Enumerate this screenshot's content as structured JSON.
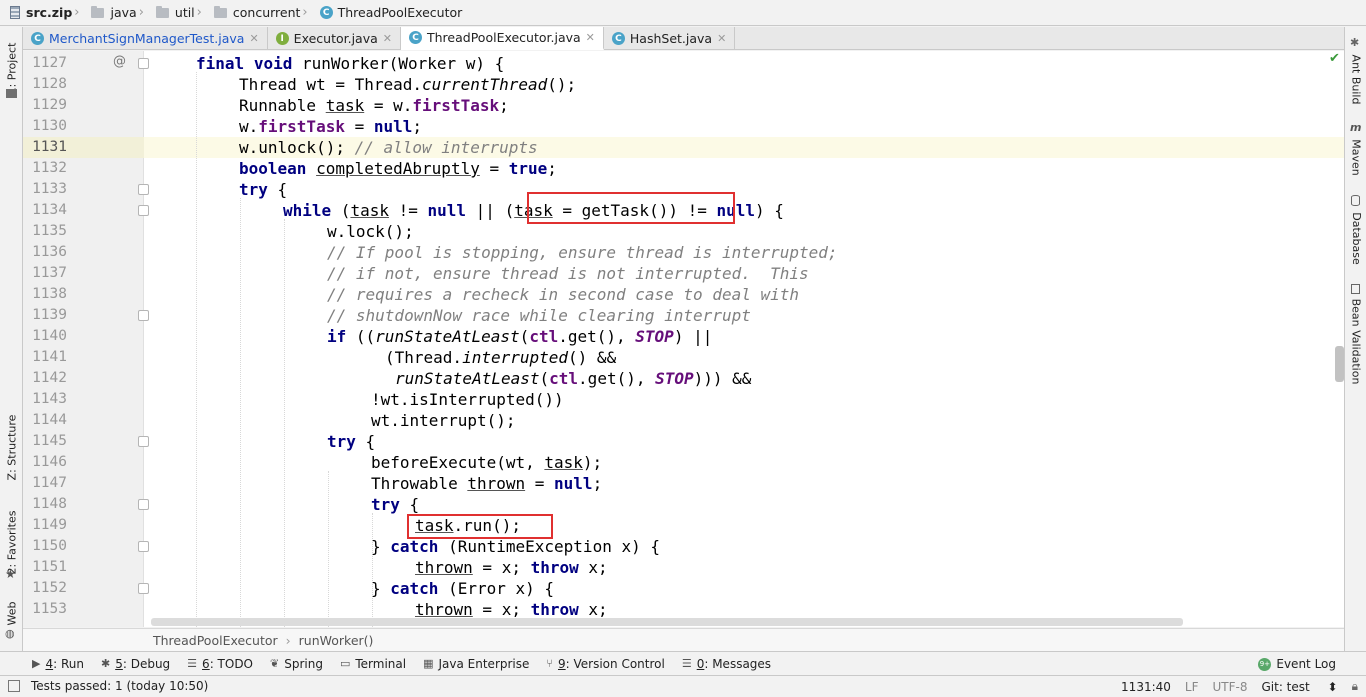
{
  "breadcrumb": {
    "items": [
      "src.zip",
      "java",
      "util",
      "concurrent",
      "ThreadPoolExecutor"
    ]
  },
  "tabs": [
    {
      "label": "MerchantSignManagerTest.java",
      "icon": "C",
      "active": false
    },
    {
      "label": "Executor.java",
      "icon": "I",
      "active": false
    },
    {
      "label": "ThreadPoolExecutor.java",
      "icon": "C",
      "active": true
    },
    {
      "label": "HashSet.java",
      "icon": "C",
      "active": false
    }
  ],
  "left_tools": [
    "1: Project",
    "Z: Structure",
    "2: Favorites",
    "Web"
  ],
  "right_tools": [
    "Ant Build",
    "Maven",
    "Database",
    "Bean Validation"
  ],
  "editor": {
    "current_line": "1131",
    "line_numbers": [
      "1127",
      "1128",
      "1129",
      "1130",
      "1131",
      "1132",
      "1133",
      "1134",
      "1135",
      "1136",
      "1137",
      "1138",
      "1139",
      "1140",
      "1141",
      "1142",
      "1143",
      "1144",
      "1145",
      "1146",
      "1147",
      "1148",
      "1149",
      "1150",
      "1151",
      "1152",
      "1153"
    ]
  },
  "code_tokens": {
    "final": "final",
    "void": "void",
    "runWorker_sig": "runWorker(Worker w) {",
    "l1128a": "Thread wt = Thread.",
    "currentThread": "currentThread",
    "l1128b": "();",
    "l1129a": "Runnable ",
    "task": "task",
    "l1129b": " = w.",
    "firstTask": "firstTask",
    "semi": ";",
    "l1130a": "w.",
    "l1130b": " = ",
    "null": "null",
    "l1131a": "w.unlock(); ",
    "l1131c": "// allow interrupts",
    "boolean": "boolean",
    "completedAbruptly": "completedAbruptly",
    "eq": " = ",
    "true": "true",
    "try": "try",
    "brace": " {",
    "while": "while",
    "l1134a": " (",
    "l1134b": " != ",
    "l1134c": " || (",
    "l1134d": " = getTask()) != ",
    "l1134e": ") {",
    "l1135": "w.lock();",
    "c1136": "// If pool is stopping, ensure thread is interrupted;",
    "c1137": "// if not, ensure thread is not interrupted.  This",
    "c1138": "// requires a recheck in second case to deal with",
    "c1139": "// shutdownNow race while clearing interrupt",
    "if": "if",
    "l1140a": " ((",
    "runStateAtLeast": "runStateAtLeast",
    "l1140b": "(",
    "ctl": "ctl",
    "l1140c": ".get(), ",
    "STOP": "STOP",
    "l1140d": ") ||",
    "l1141a": "(Thread.",
    "interrupted": "interrupted",
    "l1141b": "() &&",
    "l1142d": "))) &&",
    "l1143": "!wt.isInterrupted())",
    "l1144": "wt.interrupt();",
    "l1146a": "beforeExecute(wt, ",
    "l1146b": ");",
    "l1147a": "Throwable ",
    "thrown": "thrown",
    "l1149": ".run();",
    "l1150a": "} ",
    "catch": "catch",
    "l1150b": " (RuntimeException x) {",
    "l1151": " = x; ",
    "throw": "throw",
    "xsemi": " x;",
    "l1152b": " (Error x) {"
  },
  "nav": {
    "class": "ThreadPoolExecutor",
    "method": "runWorker()"
  },
  "tool_windows": [
    {
      "key": "4",
      "label": ": Run",
      "icon": "▶"
    },
    {
      "key": "5",
      "label": ": Debug",
      "icon": "✱"
    },
    {
      "key": "6",
      "label": ": TODO",
      "icon": "☰"
    },
    {
      "key": "",
      "label": "Spring",
      "icon": "❦"
    },
    {
      "key": "",
      "label": "Terminal",
      "icon": "▭"
    },
    {
      "key": "",
      "label": "Java Enterprise",
      "icon": "▦"
    },
    {
      "key": "9",
      "label": ": Version Control",
      "icon": "⑂"
    },
    {
      "key": "0",
      "label": ": Messages",
      "icon": "☰"
    }
  ],
  "event_log": {
    "label": "Event Log",
    "badge": "9+"
  },
  "status": {
    "message": "Tests passed: 1 (today 10:50)",
    "position": "1131:40",
    "line_sep": "LF",
    "encoding": "UTF-8",
    "vcs": "Git: test"
  },
  "colors": {
    "keyword": "#000080",
    "field": "#660e7a",
    "comment": "#808080",
    "highlight": "#e03030"
  }
}
